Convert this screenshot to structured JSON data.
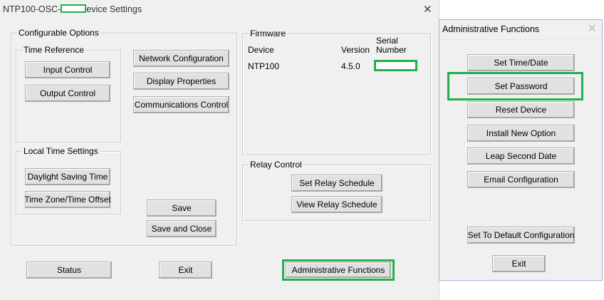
{
  "main_window": {
    "title_prefix": "NTP100-OSC-",
    "title_suffix": "evice Settings",
    "close_glyph": "✕",
    "configurable_options": {
      "label": "Configurable Options",
      "time_reference": {
        "label": "Time Reference",
        "input_control": "Input Control",
        "output_control": "Output Control"
      },
      "network_configuration": "Network Configuration",
      "display_properties": "Display Properties",
      "communications_control": "Communications Control",
      "local_time_settings": {
        "label": "Local Time Settings",
        "daylight_saving_time": "Daylight Saving Time",
        "time_zone_offset": "Time Zone/Time Offset"
      },
      "save": "Save",
      "save_and_close": "Save and Close"
    },
    "firmware": {
      "label": "Firmware",
      "col_device": "Device",
      "col_version": "Version",
      "col_serial_line1": "Serial",
      "col_serial_line2": "Number",
      "device": "NTP100",
      "version": "4.5.0"
    },
    "relay_control": {
      "label": "Relay Control",
      "set_relay_schedule": "Set Relay Schedule",
      "view_relay_schedule": "View Relay Schedule"
    },
    "status": "Status",
    "exit": "Exit",
    "administrative_functions": "Administrative Functions"
  },
  "admin_dialog": {
    "title": "Administrative Functions",
    "close_glyph": "✕",
    "set_time_date": "Set Time/Date",
    "set_password": "Set Password",
    "reset_device": "Reset Device",
    "install_new_option": "Install New Option",
    "leap_second_date": "Leap Second Date",
    "email_configuration": "Email Configuration",
    "set_default": "Set To Default Configuration",
    "exit": "Exit"
  },
  "colors": {
    "highlight": "#21b04b",
    "window_bg": "#f0f0f0"
  }
}
